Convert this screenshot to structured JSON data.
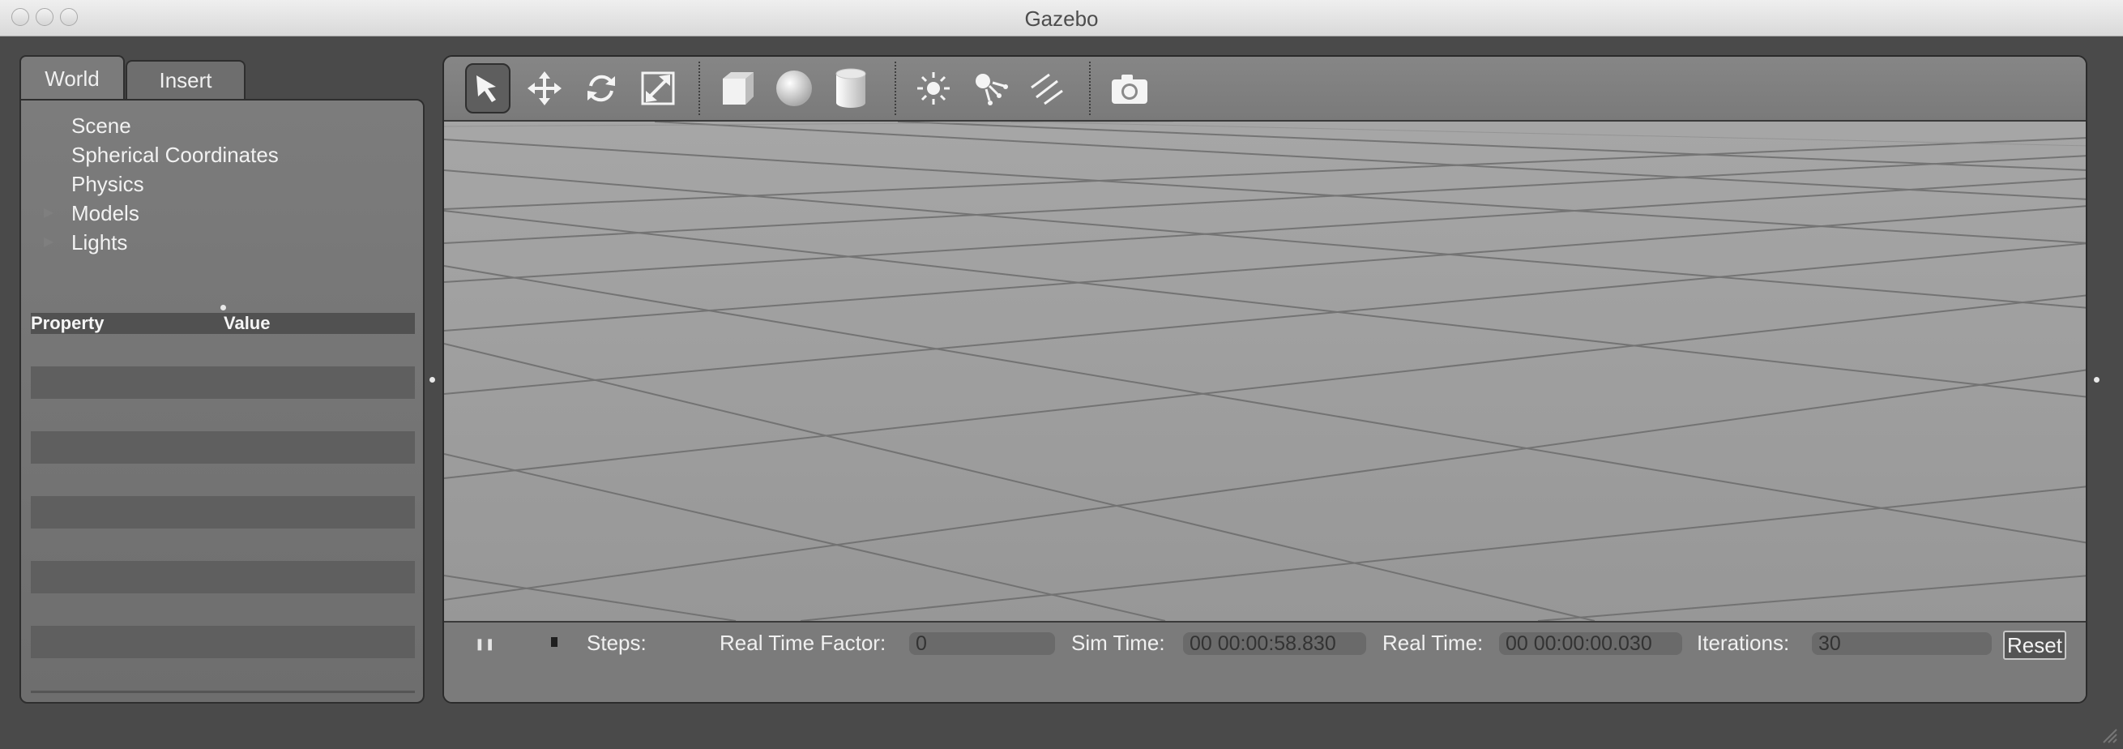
{
  "window": {
    "title": "Gazebo",
    "traffic_lights": [
      "close",
      "minimize",
      "zoom"
    ]
  },
  "left_panel": {
    "tabs": [
      {
        "label": "World",
        "active": true
      },
      {
        "label": "Insert",
        "active": false
      }
    ],
    "tree": [
      {
        "label": "Scene",
        "expandable": false
      },
      {
        "label": "Spherical Coordinates",
        "expandable": false
      },
      {
        "label": "Physics",
        "expandable": false
      },
      {
        "label": "Models",
        "expandable": true
      },
      {
        "label": "Lights",
        "expandable": true
      }
    ],
    "property_table": {
      "headers": {
        "property": "Property",
        "value": "Value"
      },
      "row_count": 5
    }
  },
  "toolbar": {
    "tools": [
      {
        "icon": "select-arrow-icon",
        "selected": true
      },
      {
        "icon": "translate-icon",
        "selected": false
      },
      {
        "icon": "rotate-icon",
        "selected": false
      },
      {
        "icon": "scale-icon",
        "selected": false
      },
      {
        "icon": "box-shape-icon",
        "selected": false
      },
      {
        "icon": "sphere-shape-icon",
        "selected": false
      },
      {
        "icon": "cylinder-shape-icon",
        "selected": false
      },
      {
        "icon": "point-light-icon",
        "selected": false
      },
      {
        "icon": "spot-light-icon",
        "selected": false
      },
      {
        "icon": "directional-light-icon",
        "selected": false
      },
      {
        "icon": "screenshot-camera-icon",
        "selected": false
      }
    ]
  },
  "status_bar": {
    "steps_label": "Steps:",
    "real_time_factor_label": "Real Time Factor:",
    "real_time_factor_value": "0",
    "sim_time_label": "Sim Time:",
    "sim_time_value": "00 00:00:58.830",
    "real_time_label": "Real Time:",
    "real_time_value": "00 00:00:00.030",
    "iterations_label": "Iterations:",
    "iterations_value": "30",
    "reset_label": "Reset"
  },
  "colors": {
    "background": "#4a4a4a",
    "panel": "#7b7b7b",
    "viewport": "#9b9b9b",
    "grid_line": "#6a6a6a"
  }
}
